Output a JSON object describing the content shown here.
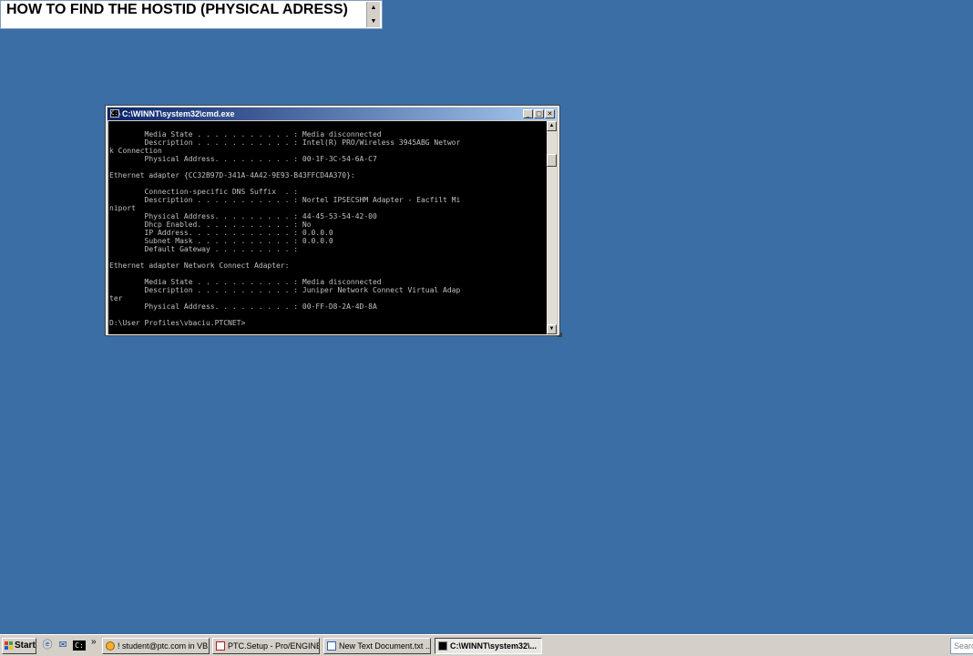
{
  "overlay": {
    "title": "HOW TO FIND THE HOSTID (PHYSICAL ADRESS)"
  },
  "cmd_window": {
    "title": "C:\\WINNT\\system32\\cmd.exe",
    "lines": [
      "        Media State . . . . . . . . . . . : Media disconnected",
      "        Description . . . . . . . . . . . : Intel(R) PRO/Wireless 3945ABG Networ",
      "k Connection",
      "        Physical Address. . . . . . . . . : 00-1F-3C-54-6A-C7",
      "",
      "Ethernet adapter {CC32B97D-341A-4A42-9E93-B43FFCD4A370}:",
      "",
      "        Connection-specific DNS Suffix  . :",
      "        Description . . . . . . . . . . . : Nortel IPSECSHM Adapter - Eacfilt Mi",
      "niport",
      "        Physical Address. . . . . . . . . : 44-45-53-54-42-00",
      "        Dhcp Enabled. . . . . . . . . . . : No",
      "        IP Address. . . . . . . . . . . . : 0.0.0.0",
      "        Subnet Mask . . . . . . . . . . . : 0.0.0.0",
      "        Default Gateway . . . . . . . . . :",
      "",
      "Ethernet adapter Network Connect Adapter:",
      "",
      "        Media State . . . . . . . . . . . : Media disconnected",
      "        Description . . . . . . . . . . . : Juniper Network Connect Virtual Adap",
      "ter",
      "        Physical Address. . . . . . . . . : 00-FF-D8-2A-4D-8A",
      "",
      "D:\\User Profiles\\vbaciu.PTCNET>"
    ]
  },
  "taskbar": {
    "start_label": "Start",
    "quick_launch": [
      "ie-icon",
      "outlook-icon",
      "cmd-icon"
    ],
    "tasks": [
      {
        "label": "! student@ptc.com in VB...",
        "icon": "browser-icon",
        "active": false
      },
      {
        "label": "PTC.Setup - Pro/ENGINE...",
        "icon": "setup-icon",
        "active": false
      },
      {
        "label": "New Text Document.txt ...",
        "icon": "notepad-icon",
        "active": false
      },
      {
        "label": "C:\\WINNT\\system32\\...",
        "icon": "cmd-icon",
        "active": true
      }
    ],
    "search_placeholder": "Search"
  }
}
